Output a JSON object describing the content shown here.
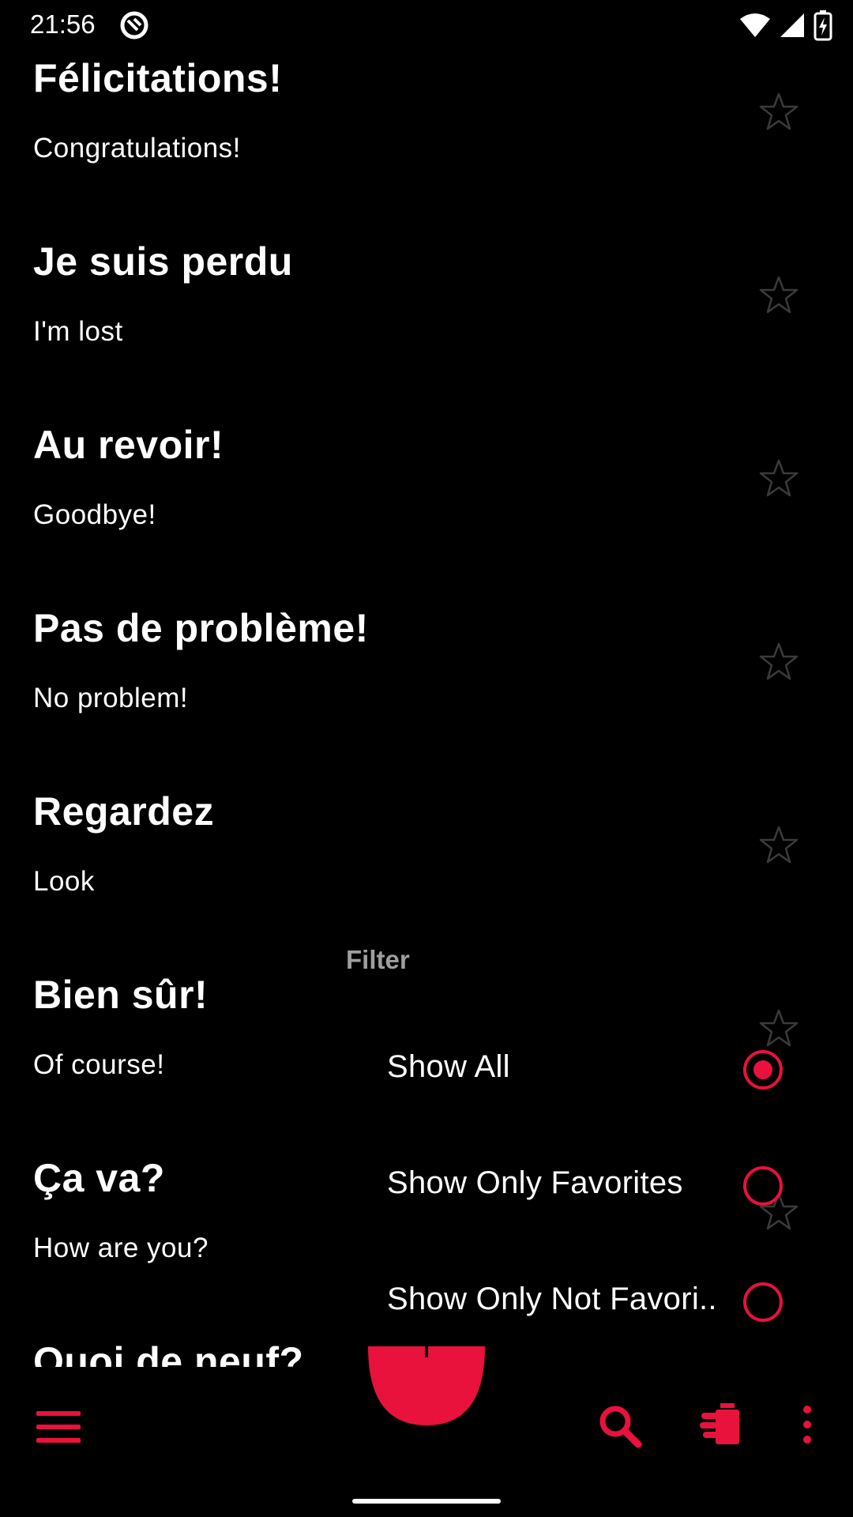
{
  "status_bar": {
    "time": "21:56",
    "icons": [
      "app-notification-icon",
      "wifi-icon",
      "signal-icon",
      "battery-charging-icon"
    ]
  },
  "phrases": [
    {
      "title": "Félicitations!",
      "translation": "Congratulations!",
      "favorite": false
    },
    {
      "title": "Je suis perdu",
      "translation": "I'm lost",
      "favorite": false
    },
    {
      "title": "Au revoir!",
      "translation": "Goodbye!",
      "favorite": false
    },
    {
      "title": "Pas de problème!",
      "translation": "No problem!",
      "favorite": false
    },
    {
      "title": "Regardez",
      "translation": "Look",
      "favorite": false
    },
    {
      "title": "Bien sûr!",
      "translation": "Of course!",
      "favorite": false
    },
    {
      "title": "Ça va?",
      "translation": "How are you?",
      "favorite": false
    },
    {
      "title": "Quoi de neuf?",
      "translation": "",
      "favorite": false
    }
  ],
  "filter": {
    "title": "Filter",
    "options": [
      {
        "label": "Show All",
        "selected": true
      },
      {
        "label": "Show Only Favorites",
        "selected": false
      },
      {
        "label": "Show Only Not Favori..",
        "selected": false
      }
    ]
  },
  "bottom_bar": {
    "icons": [
      "menu-icon",
      "search-icon",
      "delete-sweep-icon",
      "more-vert-icon"
    ],
    "fab_icon": "add-icon"
  },
  "colors": {
    "background": "#000000",
    "accent": "#E8123C",
    "star_outline": "#3a3a3a",
    "muted_text": "#9e9e9e"
  }
}
